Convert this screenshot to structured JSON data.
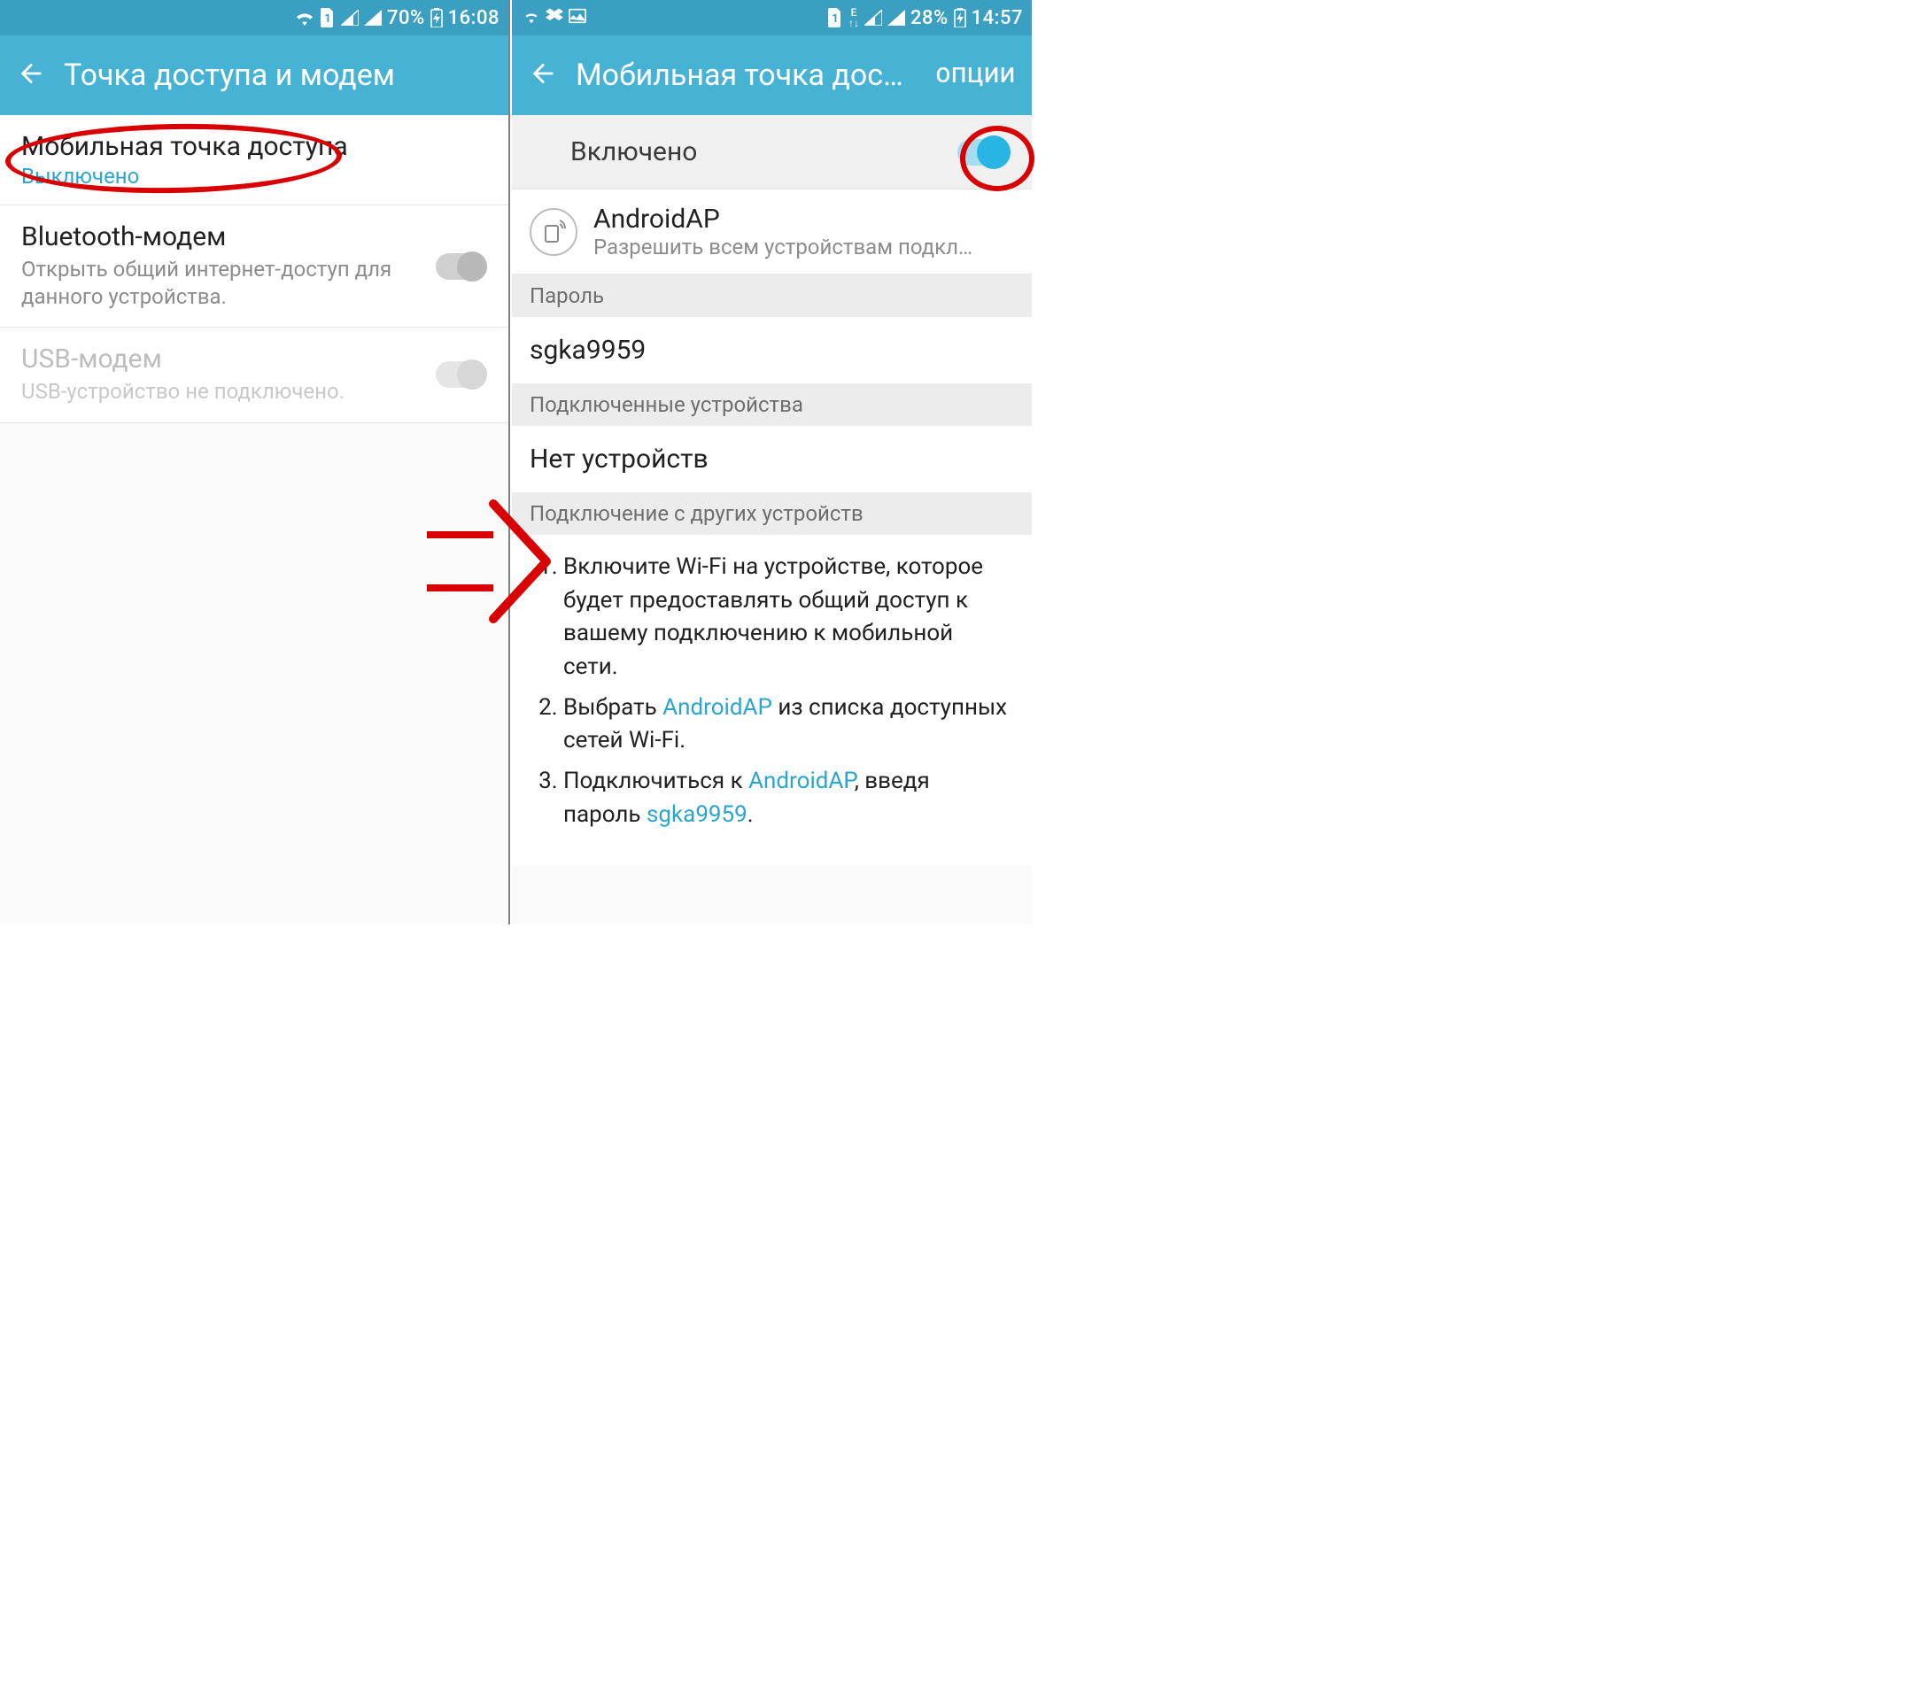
{
  "left": {
    "status": {
      "battery": "70%",
      "time": "16:08",
      "sim": "1"
    },
    "title": "Точка доступа и модем",
    "mobile_hotspot": {
      "title": "Мобильная точка доступа",
      "state": "Выключено"
    },
    "bt_tether": {
      "title": "Bluetooth-модем",
      "desc": "Открыть общий интернет-доступ для данного устройства."
    },
    "usb_tether": {
      "title": "USB-модем",
      "desc": "USB-устройство не подключено."
    }
  },
  "right": {
    "status": {
      "battery": "28%",
      "time": "14:57",
      "sim": "1"
    },
    "title": "Мобильная точка дост…",
    "options": "ОПЦИИ",
    "enabled_label": "Включено",
    "ap": {
      "name": "AndroidAP",
      "desc": "Разрешить всем устройствам подключ…"
    },
    "password_header": "Пароль",
    "password_value": "sgka9959",
    "connected_header": "Подключенные устройства",
    "connected_value": "Нет устройств",
    "howto_header": "Подключение с других устройств",
    "steps": {
      "s1": "Включите Wi-Fi на устройстве, которое будет предоставлять общий доступ к вашему подключению к мобильной сети.",
      "s2a": "Выбрать ",
      "s2b": " из списка доступных сетей Wi-Fi.",
      "s3a": "Подключиться к ",
      "s3b": ", введя пароль ",
      "ssid": "AndroidAP",
      "pw": "sgka9959",
      "dot": "."
    }
  }
}
